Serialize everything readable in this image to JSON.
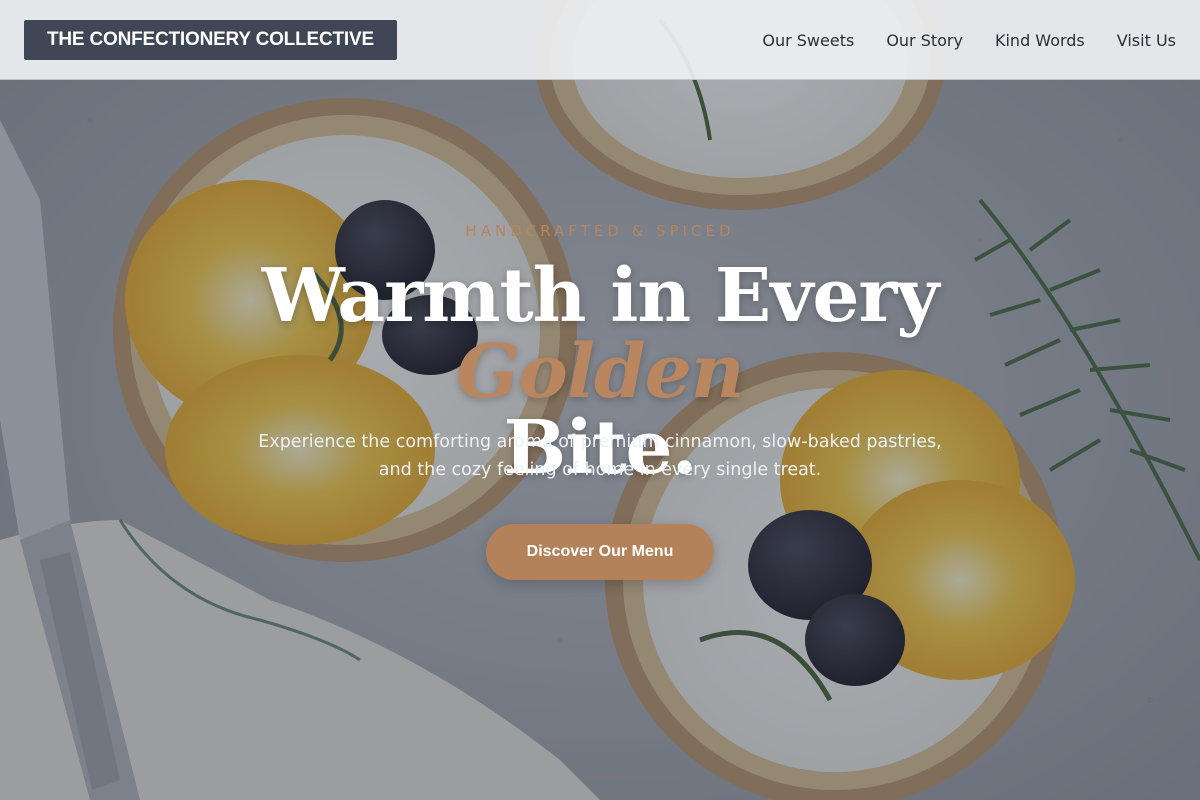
{
  "header": {
    "brand": "THE CONFECTIONERY COLLECTIVE",
    "nav": [
      {
        "label": "Our Sweets"
      },
      {
        "label": "Our Story"
      },
      {
        "label": "Kind Words"
      },
      {
        "label": "Visit Us"
      }
    ]
  },
  "hero": {
    "eyebrow": "HANDCRAFTED & SPICED",
    "headline_main": "Warmth in Every",
    "headline_accent": "Golden",
    "headline_tail": "Bite.",
    "subtext": "Experience the comforting aroma of premium cinnamon, slow-baked pastries, and the cozy feeling of home in every single treat.",
    "cta_label": "Discover Our Menu",
    "background_image": "tarts-with-orange-and-blackberries-photo"
  },
  "colors": {
    "accent": "#b3825a",
    "brand_bg": "#3f4756",
    "header_bg": "#eeeff2"
  }
}
